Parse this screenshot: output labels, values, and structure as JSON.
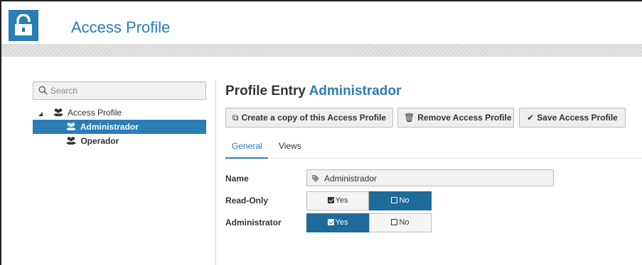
{
  "header": {
    "title": "Access Profile",
    "icon": "unlocked-padlock-icon",
    "accent": "#2a7db5"
  },
  "sidebar": {
    "search_placeholder": "Search",
    "tree": {
      "root_label": "Access Profile",
      "items": [
        {
          "label": "Administrador",
          "selected": true
        },
        {
          "label": "Operador",
          "selected": false
        }
      ]
    }
  },
  "main": {
    "title_prefix": "Profile Entry",
    "title_name": "Administrador",
    "buttons": {
      "copy": "Create a copy of this Access Profile",
      "remove": "Remove Access Profile",
      "save": "Save Access Profile"
    },
    "tabs": [
      {
        "label": "General",
        "active": true
      },
      {
        "label": "Views",
        "active": false
      }
    ],
    "form": {
      "name_label": "Name",
      "name_value": "Administrador",
      "readonly_label": "Read-Only",
      "readonly_yes": "Yes",
      "readonly_no": "No",
      "readonly_value": "No",
      "admin_label": "Administrator",
      "admin_yes": "Yes",
      "admin_no": "No",
      "admin_value": "Yes"
    }
  }
}
